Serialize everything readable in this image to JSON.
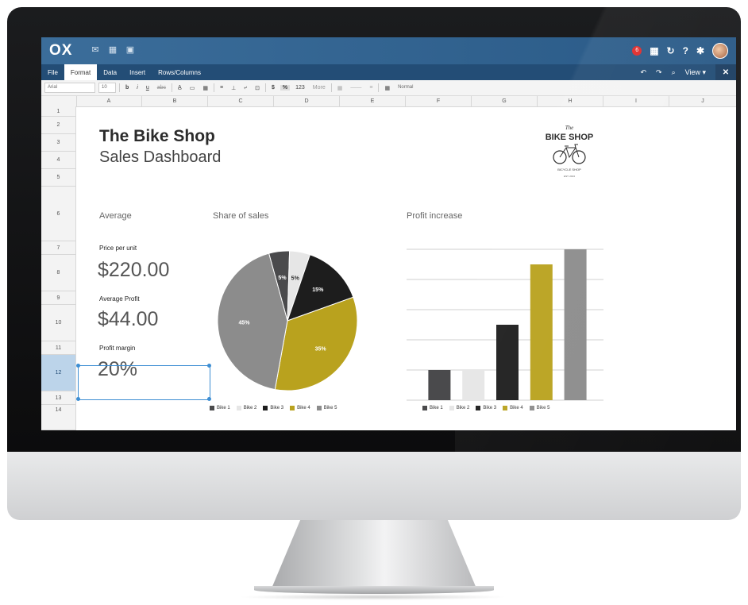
{
  "app": {
    "logo": "OX",
    "notification_count": "6"
  },
  "menu": {
    "items": [
      "File",
      "Format",
      "Data",
      "Insert",
      "Rows/Columns"
    ],
    "active": "Format",
    "view_label": "View",
    "close_label": "✕"
  },
  "toolbar": {
    "font_family": "Arial",
    "font_size": "10",
    "bold": "b",
    "italic": "i",
    "underline": "u",
    "strike": "abc",
    "currency": "$",
    "percent": "%",
    "number_format": "123",
    "more": "More",
    "style": "Normal"
  },
  "grid": {
    "columns": [
      "A",
      "B",
      "C",
      "D",
      "E",
      "F",
      "G",
      "H",
      "I",
      "J"
    ],
    "rows": [
      "1",
      "2",
      "3",
      "4",
      "5",
      "6",
      "7",
      "8",
      "9",
      "10",
      "11",
      "12",
      "13",
      "14"
    ],
    "selected_row": "12"
  },
  "dashboard": {
    "title": "The Bike Shop",
    "subtitle": "Sales Dashboard",
    "average_label": "Average",
    "share_label": "Share of sales",
    "profit_label": "Profit increase",
    "price_label": "Price per unit",
    "price_value": "$220.00",
    "avg_profit_label": "Average Profit",
    "avg_profit_value": "$44.00",
    "margin_label": "Profit margin",
    "margin_value": "20%"
  },
  "logo": {
    "the": "The",
    "name": "BIKE SHOP",
    "tagline": "BICYCLE SHOP"
  },
  "colors": {
    "bike1": "#4a4a4c",
    "bike2": "#e6e6e6",
    "bike3": "#1d1d1d",
    "bike4": "#b9a21e",
    "bike5": "#8c8c8c",
    "topbar": "#2f6190",
    "selection": "#3d8ed3"
  },
  "chart_data": [
    {
      "type": "pie",
      "title": "Share of sales",
      "categories": [
        "Bike 1",
        "Bike 2",
        "Bike 3",
        "Bike 4",
        "Bike 5"
      ],
      "values": [
        5,
        5,
        15,
        35,
        45
      ],
      "labels": [
        "5%",
        "5%",
        "15%",
        "35%",
        "45%"
      ],
      "legend": "bottom"
    },
    {
      "type": "bar",
      "title": "Profit increase",
      "categories": [
        "Bike 1",
        "Bike 2",
        "Bike 3",
        "Bike 4",
        "Bike 5"
      ],
      "values": [
        2,
        2,
        5,
        9,
        10
      ],
      "ylim": [
        0,
        10
      ],
      "grid": true,
      "legend": "bottom"
    }
  ]
}
